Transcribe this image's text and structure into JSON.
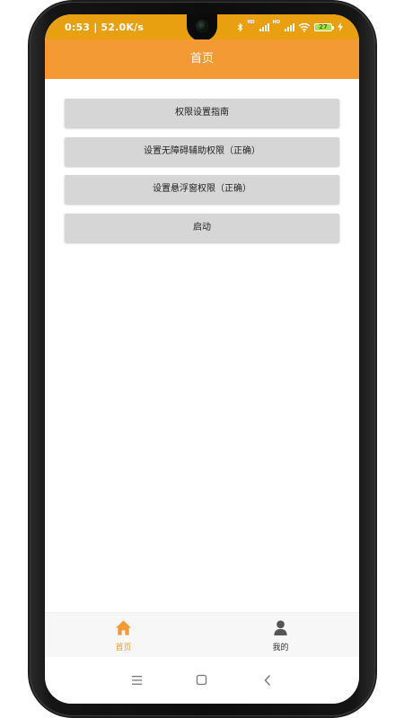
{
  "status_bar": {
    "time_speed": "0:53 | 52.0K/s",
    "signal_label_1": "HD",
    "signal_label_2": "HD",
    "battery_level": "27",
    "color": "#e8a011"
  },
  "app_bar": {
    "title": "首页",
    "color": "#f39a35"
  },
  "buttons": [
    {
      "label": "权限设置指南"
    },
    {
      "label": "设置无障碍辅助权限（正确）"
    },
    {
      "label": "设置悬浮窗权限（正确）"
    },
    {
      "label": "启动"
    }
  ],
  "tab_bar": {
    "tabs": [
      {
        "label": "首页",
        "icon": "home-icon",
        "active": true
      },
      {
        "label": "我的",
        "icon": "person-icon",
        "active": false
      }
    ],
    "active_color": "#f39a35",
    "inactive_color": "#555555"
  },
  "nav_bar": {
    "icons": [
      "menu-icon",
      "home-square-icon",
      "back-icon"
    ]
  }
}
